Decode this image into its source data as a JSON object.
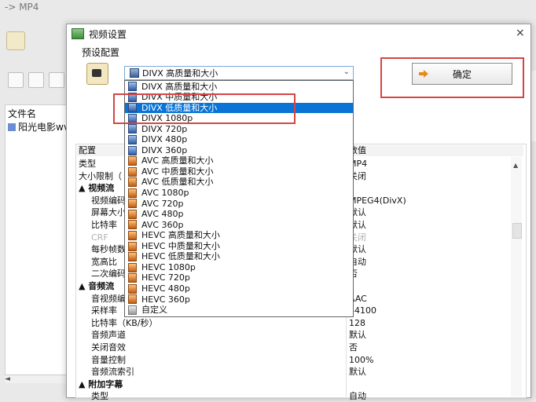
{
  "background_app": {
    "title": "-> MP4",
    "list_header": "文件名",
    "list_item": "阳光电影wv",
    "scroll_left": "◄"
  },
  "dialog": {
    "title": "视频设置",
    "close": "×",
    "preset_label": "预设配置",
    "selected_preset": "DIVX 高质量和大小",
    "ok_label": "确定",
    "dropdown_arrow": "⌄"
  },
  "dropdown_items": [
    {
      "label": "DIVX 高质量和大小",
      "icon": "blue"
    },
    {
      "label": "DIVX 中质量和大小",
      "icon": "blue"
    },
    {
      "label": "DIVX 低质量和大小",
      "icon": "blue",
      "selected": true
    },
    {
      "label": "DIVX 1080p",
      "icon": "blue"
    },
    {
      "label": "DIVX 720p",
      "icon": "blue"
    },
    {
      "label": "DIVX 480p",
      "icon": "blue"
    },
    {
      "label": "DIVX 360p",
      "icon": "blue"
    },
    {
      "label": "AVC 高质量和大小",
      "icon": "orange"
    },
    {
      "label": "AVC 中质量和大小",
      "icon": "orange"
    },
    {
      "label": "AVC 低质量和大小",
      "icon": "orange"
    },
    {
      "label": "AVC 1080p",
      "icon": "orange"
    },
    {
      "label": "AVC 720p",
      "icon": "orange"
    },
    {
      "label": "AVC 480p",
      "icon": "orange"
    },
    {
      "label": "AVC 360p",
      "icon": "orange"
    },
    {
      "label": "HEVC 高质量和大小",
      "icon": "orange"
    },
    {
      "label": "HEVC 中质量和大小",
      "icon": "orange"
    },
    {
      "label": "HEVC 低质量和大小",
      "icon": "orange"
    },
    {
      "label": "HEVC 1080p",
      "icon": "orange"
    },
    {
      "label": "HEVC 720p",
      "icon": "orange"
    },
    {
      "label": "HEVC 480p",
      "icon": "orange"
    },
    {
      "label": "HEVC 360p",
      "icon": "orange"
    },
    {
      "label": "自定义",
      "icon": "gray"
    }
  ],
  "property_grid": {
    "header": {
      "key": "配置",
      "value": "数值"
    },
    "rows": [
      {
        "key": "类型",
        "value": "MP4",
        "kind": "plain"
      },
      {
        "key": "大小限制（",
        "value": "关闭",
        "kind": "plain"
      },
      {
        "key": "▲ 视频流",
        "value": "",
        "kind": "cat"
      },
      {
        "key": "视频编码",
        "value": "MPEG4(DivX)",
        "kind": "sub"
      },
      {
        "key": "屏幕大小",
        "value": "默认",
        "kind": "sub"
      },
      {
        "key": "比特率",
        "value": "默认",
        "kind": "sub"
      },
      {
        "key": "CRF",
        "value": "关闭",
        "kind": "disabled"
      },
      {
        "key": "每秒帧数",
        "value": "默认",
        "kind": "sub"
      },
      {
        "key": "宽高比",
        "value": "自动",
        "kind": "sub"
      },
      {
        "key": "二次编码",
        "value": "否",
        "kind": "sub"
      },
      {
        "key": "▲ 音频流",
        "value": "",
        "kind": "cat"
      },
      {
        "key": "音视频编",
        "value": "AAC",
        "kind": "sub"
      },
      {
        "key": "采样率",
        "value": "44100",
        "kind": "sub"
      },
      {
        "key": "比特率（KB/秒）",
        "value": "128",
        "kind": "sub"
      },
      {
        "key": "音频声道",
        "value": "默认",
        "kind": "sub"
      },
      {
        "key": "关闭音效",
        "value": "否",
        "kind": "sub"
      },
      {
        "key": "音量控制",
        "value": "100%",
        "kind": "sub"
      },
      {
        "key": "音频流索引",
        "value": "默认",
        "kind": "sub"
      },
      {
        "key": "▲ 附加字幕",
        "value": "",
        "kind": "cat"
      },
      {
        "key": "类型",
        "value": "自动",
        "kind": "sub"
      }
    ]
  },
  "colors": {
    "highlight": "#0a74d6",
    "annotation_red": "#d64545"
  }
}
